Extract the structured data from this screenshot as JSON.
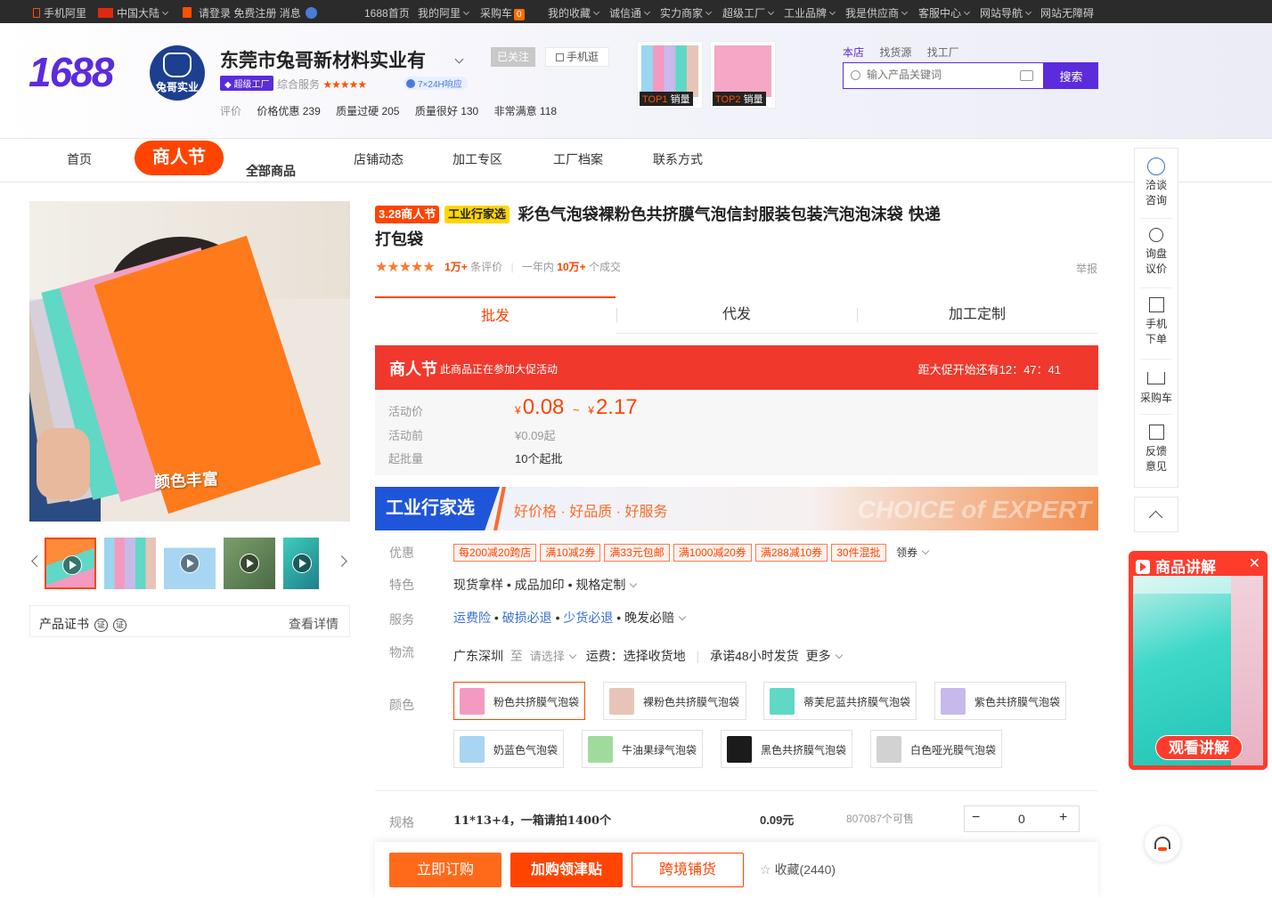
{
  "topbar": {
    "mobile": "手机阿里",
    "region": "中国大陆",
    "login": "请登录",
    "register": "免费注册",
    "messages": "消息",
    "links": [
      "1688首页",
      "我的阿里",
      "采购车",
      "我的收藏",
      "诚信通",
      "实力商家",
      "超级工厂",
      "工业品牌",
      "我是供应商",
      "客服中心",
      "网站导航",
      "网站无障碍"
    ],
    "cart_count": "0"
  },
  "header": {
    "logo": "1688",
    "avatar_text": "兔哥实业",
    "shop_name": "东莞市兔哥新材料实业有",
    "follow": "已关注",
    "mobile_shop": "手机逛",
    "super_factory": "超级工厂",
    "service_label": "综合服务",
    "service_stars": "★★★★★",
    "response": "7×24H响应",
    "ratings_label": "评价",
    "ratings": [
      {
        "label": "价格优惠",
        "count": "239"
      },
      {
        "label": "质量过硬",
        "count": "205"
      },
      {
        "label": "质量很好",
        "count": "130"
      },
      {
        "label": "非常满意",
        "count": "118"
      }
    ],
    "top1": {
      "rank": "TOP1",
      "label": "销量"
    },
    "top2": {
      "rank": "TOP2",
      "label": "销量"
    },
    "search_tabs": [
      "本店",
      "找货源",
      "找工厂"
    ],
    "search_placeholder": "输入产品关键词",
    "search_button": "搜索"
  },
  "nav": {
    "home": "首页",
    "festival": "商人节",
    "all_products": "全部商品",
    "news": "店铺动态",
    "processing": "加工专区",
    "factory": "工厂档案",
    "contact": "联系方式"
  },
  "gallery": {
    "overlay_text": "颜色丰富",
    "certificate": "产品证书",
    "cert_icon": "证",
    "details": "查看详情"
  },
  "product": {
    "tag_festival": "3.28商人节",
    "tag_industry": "工业行家选",
    "title": "彩色气泡袋裸粉色共挤膜气泡信封服装包装汽泡泡沫袋 快递打包袋",
    "stars": "★★★★★",
    "reviews": "1万+",
    "reviews_unit": "条评价",
    "year_label": "一年内",
    "deals": "10万+",
    "deals_unit": "个成交",
    "report": "举报"
  },
  "tabs": [
    "批发",
    "代发",
    "加工定制"
  ],
  "promo": {
    "title": "商人节",
    "subtitle": "此商品正在参加大促活动",
    "countdown_label": "距大促开始还有",
    "countdown": "12：47：41"
  },
  "price": {
    "activity_label": "活动价",
    "currency": "¥",
    "low": "0.08",
    "tilde": "~",
    "high": "2.17",
    "before_label": "活动前",
    "before_value": "¥0.09起",
    "moq_label": "起批量",
    "moq_value": "10个起批"
  },
  "industry": {
    "title": "工业行家选",
    "slogan": "好价格 · 好品质 · 好服务",
    "en": "CHOICE of EXPERT"
  },
  "offers": {
    "label": "优惠",
    "coupons": [
      "每200减20跨店",
      "满10减2券",
      "满33元包邮",
      "满1000减20券",
      "满288减10券",
      "30件混批"
    ],
    "get_coupon": "领券"
  },
  "features": {
    "label": "特色",
    "value": "现货拿样 • 成品加印 • 规格定制"
  },
  "service": {
    "label": "服务",
    "items": [
      "运费险",
      "破损必退",
      "少货必退",
      "晚发必赔"
    ],
    "sep": "•"
  },
  "logistics": {
    "label": "物流",
    "from": "广东深圳",
    "to": "至",
    "choose": "请选择",
    "fee": "运费：选择收货地",
    "promise": "承诺48小时发货",
    "more": "更多"
  },
  "colors": {
    "label": "颜色",
    "items": [
      {
        "name": "粉色共挤膜气泡袋",
        "color": "#f49ac0"
      },
      {
        "name": "裸粉色共挤膜气泡袋",
        "color": "#e8c4b8"
      },
      {
        "name": "蒂芙尼蓝共挤膜气泡袋",
        "color": "#5fd8c6"
      },
      {
        "name": "紫色共挤膜气泡袋",
        "color": "#c7b9ea"
      },
      {
        "name": "奶蓝色气泡袋",
        "color": "#a8d6f2"
      },
      {
        "name": "牛油果绿气泡袋",
        "color": "#9fdc9c"
      },
      {
        "name": "黑色共挤膜气泡袋",
        "color": "#1b1b1b"
      },
      {
        "name": "白色哑光膜气泡袋",
        "color": "#d2d2d2"
      }
    ]
  },
  "spec": {
    "label": "规格",
    "name": "11*13+4，一箱请拍1400个",
    "price": "0.09元",
    "stock": "807087个可售",
    "minus": "−",
    "qty": "0",
    "plus": "+"
  },
  "actions": {
    "buy": "立即订购",
    "add_cart": "加购领津贴",
    "cross": "跨境铺货",
    "favorite": "收藏(2440)"
  },
  "sidebar": {
    "items": [
      "洽谈咨询",
      "询盘议价",
      "手机下单",
      "采购车",
      "反馈意见"
    ]
  },
  "video": {
    "title": "商品讲解",
    "close": "✕",
    "cta": "观看讲解"
  },
  "accent": "#ff4400",
  "brand": "#5b2bdc"
}
